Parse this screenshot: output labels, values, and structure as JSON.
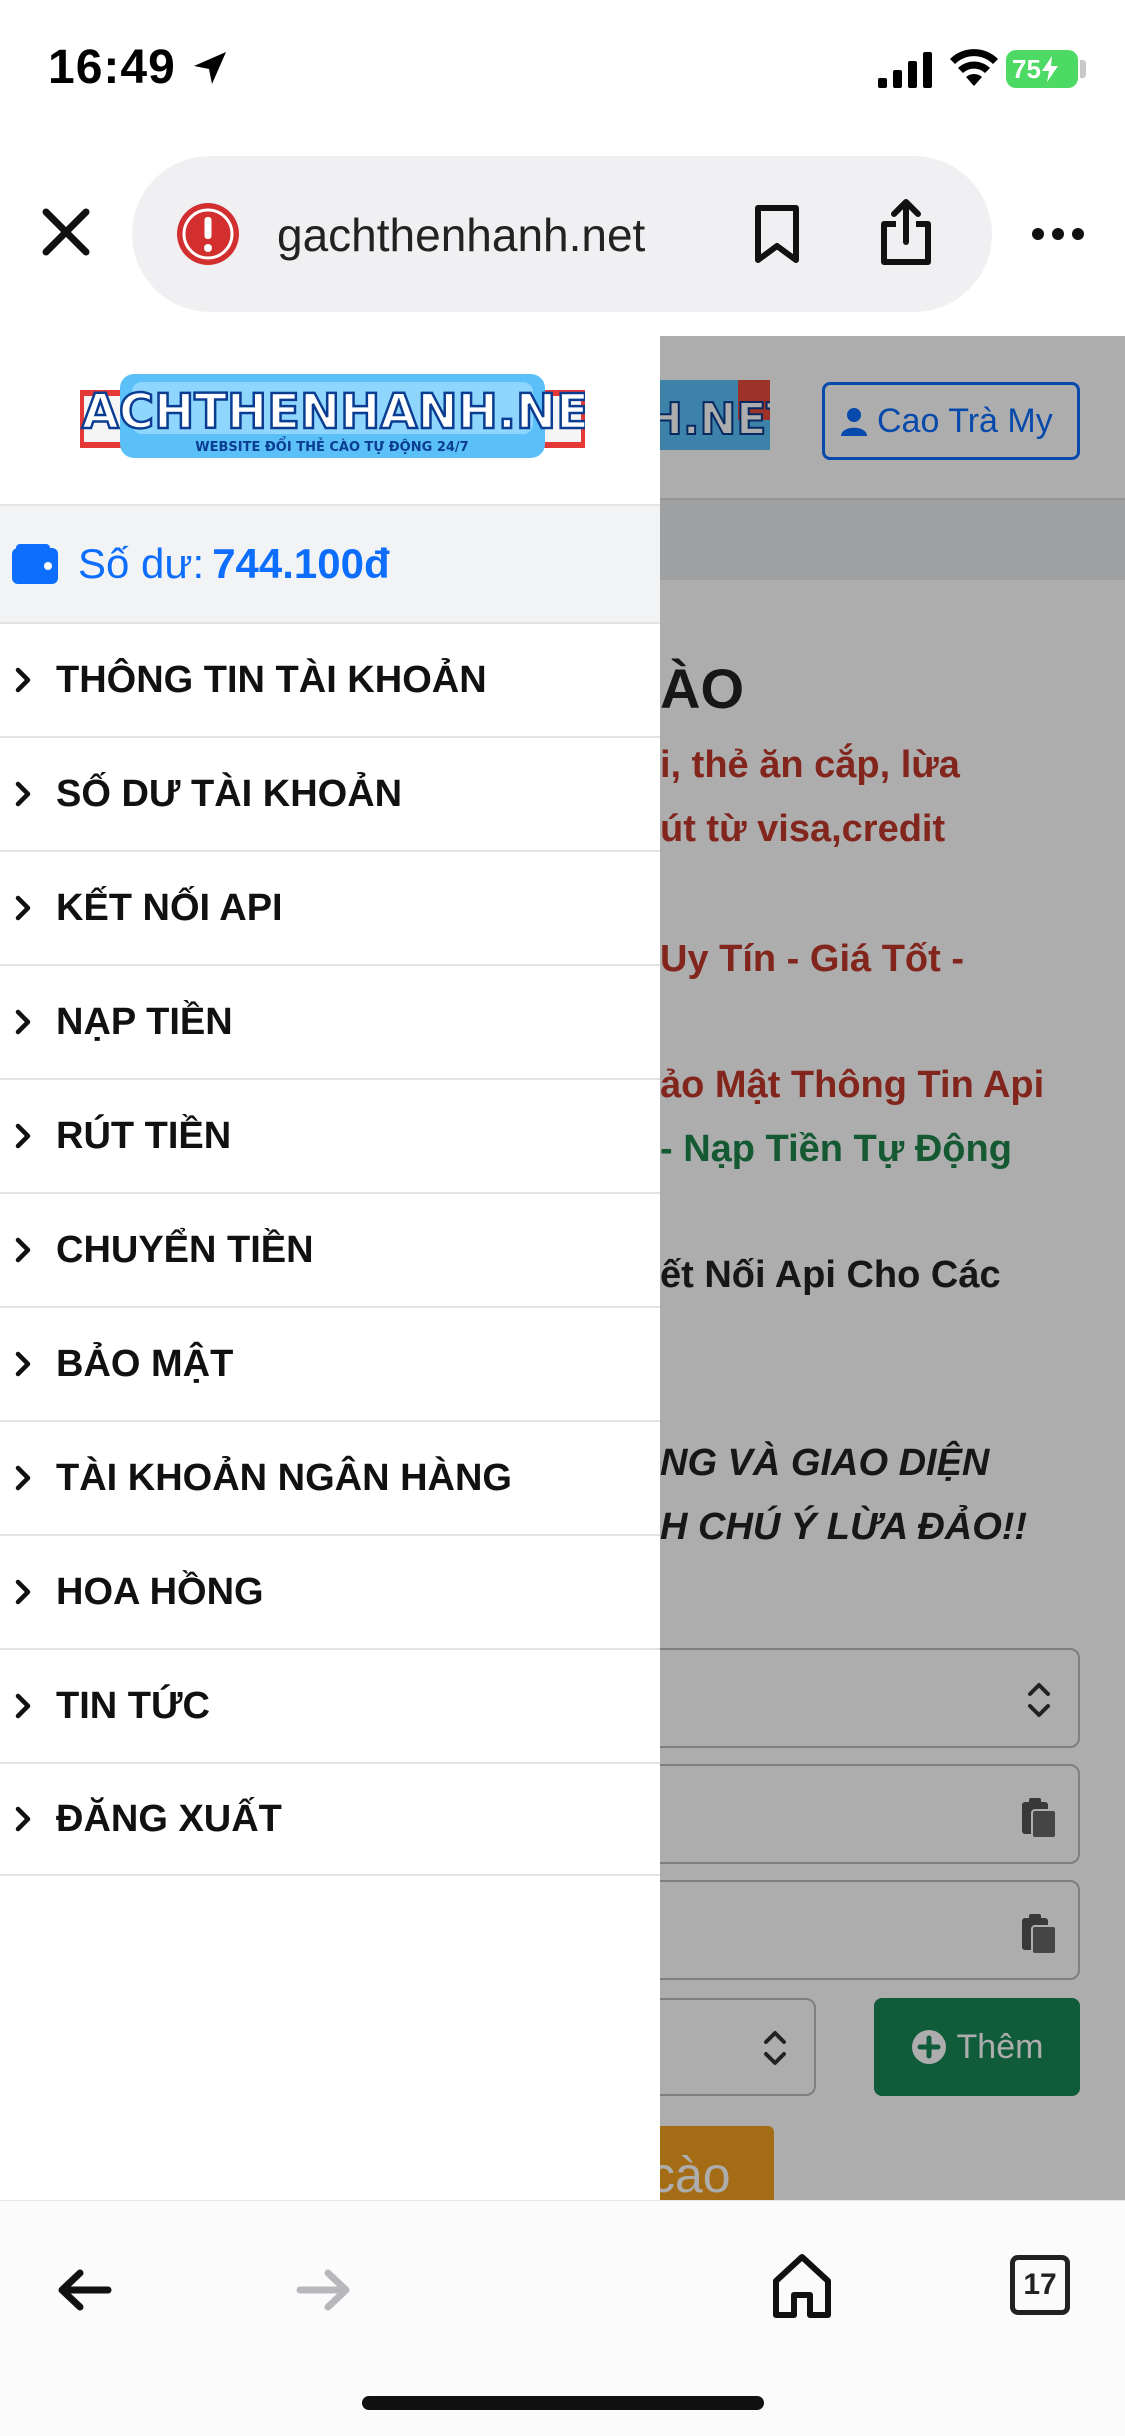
{
  "status_bar": {
    "time": "16:49",
    "battery": "75"
  },
  "browser": {
    "url": "gachthenhanh.net"
  },
  "page": {
    "user_button": "Cao Trà My",
    "heading_fragment": "ÀO",
    "lines": [
      {
        "text": "i, thẻ ăn cắp, lừa",
        "color": "red"
      },
      {
        "text": "út từ visa,credit",
        "color": "red"
      },
      {
        "text": "Uy Tín - Giá Tốt -",
        "color": "red"
      },
      {
        "text": "ảo Mật Thông Tin Api",
        "color": "red"
      },
      {
        "text": "- Nạp Tiền Tự Động",
        "color": "green"
      },
      {
        "text": "ết Nối Api Cho Các",
        "color": "dark"
      },
      {
        "text": "NG VÀ GIAO DIỆN",
        "color": "dark"
      },
      {
        "text": "H CHÚ Ý LỪA ĐẢO!!",
        "color": "dark"
      }
    ],
    "add_button": "Thêm",
    "submit_button_fragment": "cào"
  },
  "drawer": {
    "logo_text": "GACHTHENHANH.NET",
    "logo_tagline": "WEBSITE ĐỔI THẺ CÀO TỰ ĐỘNG 24/7",
    "balance_label": "Số dư:",
    "balance_value": "744.100đ",
    "menu": [
      "THÔNG TIN TÀI KHOẢN",
      "SỐ DƯ TÀI KHOẢN",
      "KẾT NỐI API",
      "NẠP TIỀN",
      "RÚT TIỀN",
      "CHUYỂN TIỀN",
      "BẢO MẬT",
      "TÀI KHOẢN NGÂN HÀNG",
      "HOA HỒNG",
      "TIN TỨC",
      "ĐĂNG XUẤT"
    ]
  },
  "toolbar": {
    "tab_count": "17"
  },
  "colors": {
    "primary": "#0d6efd",
    "red_text": "#c0392b",
    "green_text": "#1e8449",
    "add_button": "#198754",
    "submit_button": "#f0a020",
    "battery": "#4cd964",
    "warning": "#d32f2f"
  }
}
